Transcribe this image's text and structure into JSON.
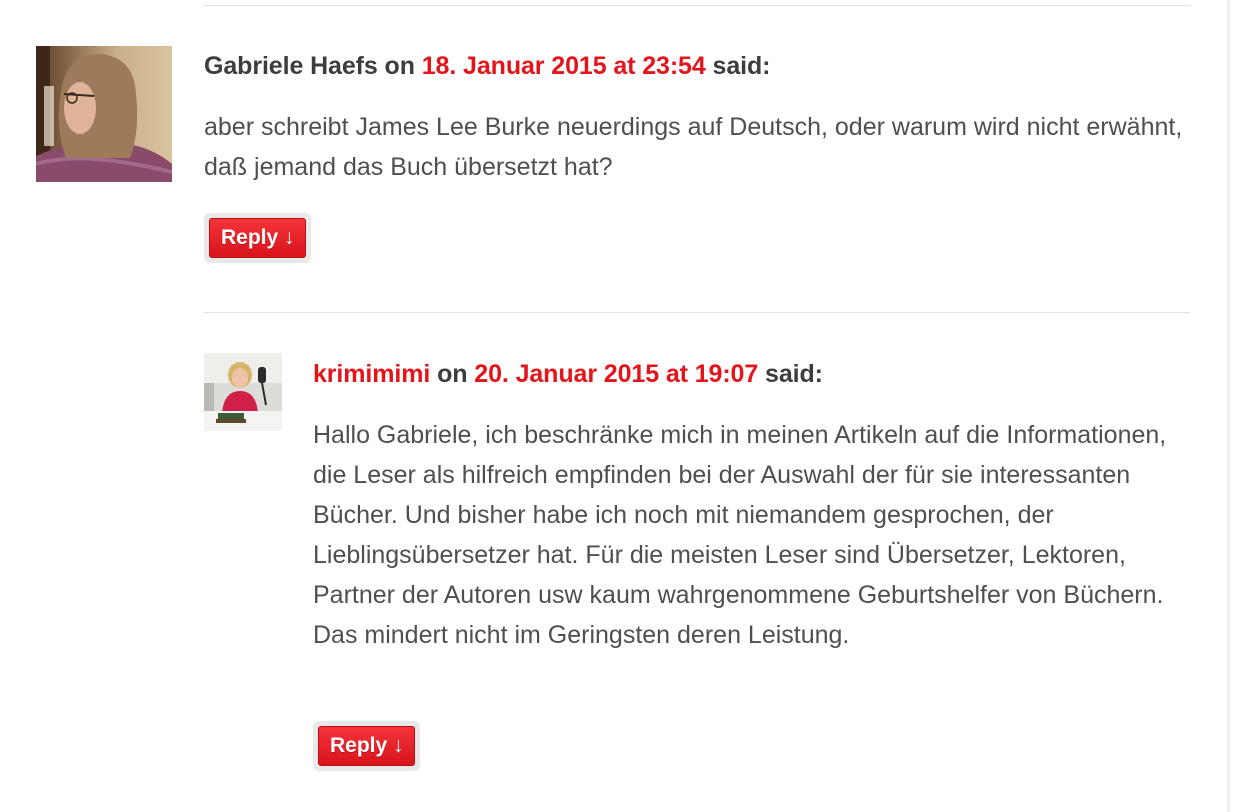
{
  "comments": [
    {
      "author": "Gabriele Haefs",
      "on": "on",
      "date": "18. Januar 2015 at 23:54",
      "said": "said:",
      "text": "aber schreibt James Lee Burke neuerdings auf Deutsch, oder warum wird nicht erwähnt, daß jemand das Buch übersetzt hat?",
      "reply_label": "Reply ↓",
      "avatar_icon": "person-photo"
    },
    {
      "author": "krimimimi",
      "on": "on",
      "date": "20. Januar 2015 at 19:07",
      "said": "said:",
      "text": "Hallo Gabriele, ich beschränke mich in meinen Artikeln auf die Informationen, die Leser als hilfreich empfinden bei der Auswahl der für sie interessanten Bücher. Und bisher habe ich noch mit niemandem gesprochen, der Lieblingsübersetzer hat. Für die meisten Leser sind Übersetzer, Lektoren, Partner der Autoren usw kaum wahrgenommene Geburtshelfer von Büchern. Das mindert nicht im Geringsten deren Leistung.",
      "reply_label": "Reply ↓",
      "avatar_icon": "person-with-microphone-photo"
    }
  ],
  "colors": {
    "accent": "#e3151b",
    "text": "#4f4f4f",
    "author": "#3d3d3d"
  }
}
